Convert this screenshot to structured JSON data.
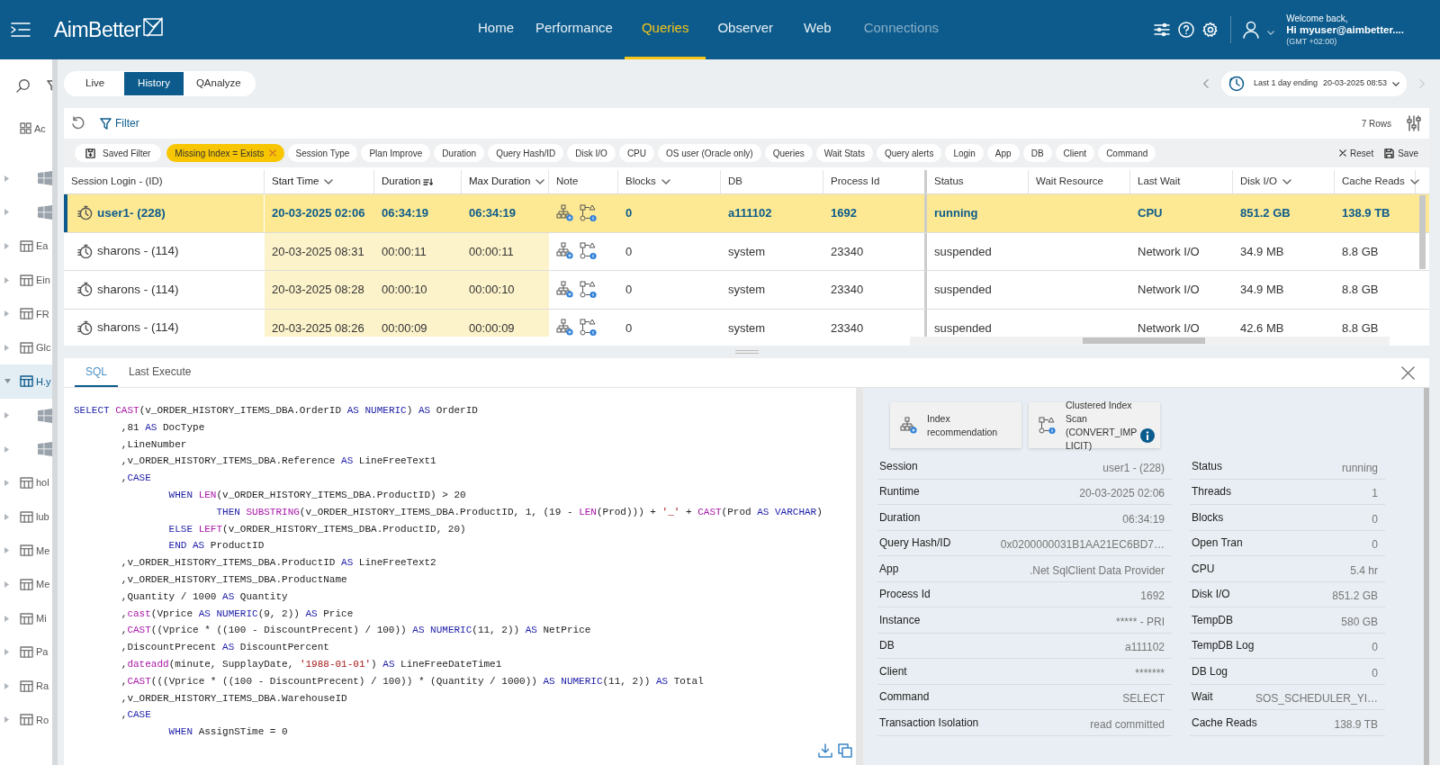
{
  "header": {
    "logo": "AimBetter",
    "nav": [
      {
        "label": "Home",
        "selected": false,
        "disabled": false
      },
      {
        "label": "Performance",
        "selected": false,
        "disabled": false
      },
      {
        "label": "Queries",
        "selected": true,
        "disabled": false
      },
      {
        "label": "Observer",
        "selected": false,
        "disabled": false
      },
      {
        "label": "Web",
        "selected": false,
        "disabled": false
      },
      {
        "label": "Connections",
        "selected": false,
        "disabled": true
      }
    ],
    "user": {
      "greeting": "Welcome back,",
      "name": "Hi myuser@aimbetter....",
      "timezone": "(GMT +02:00)"
    }
  },
  "sidebar": {
    "items": [
      {
        "kind": "grid",
        "label": "Ac",
        "selected": false
      },
      {
        "kind": "windows",
        "selected": false
      },
      {
        "kind": "windows",
        "selected": false
      },
      {
        "kind": "table",
        "label": "Ea",
        "selected": false
      },
      {
        "kind": "table",
        "label": "Ein",
        "selected": false
      },
      {
        "kind": "table",
        "label": "FR",
        "selected": false
      },
      {
        "kind": "table",
        "label": "Glc",
        "selected": false
      },
      {
        "kind": "table",
        "label": "H.y",
        "selected": true
      },
      {
        "kind": "windows",
        "selected": false
      },
      {
        "kind": "windows",
        "selected": false
      },
      {
        "kind": "table",
        "label": "hol",
        "selected": false
      },
      {
        "kind": "table",
        "label": "lub",
        "selected": false
      },
      {
        "kind": "table",
        "label": "Me",
        "selected": false
      },
      {
        "kind": "table",
        "label": "Me",
        "selected": false
      },
      {
        "kind": "table",
        "label": "Mi",
        "selected": false
      },
      {
        "kind": "table",
        "label": "Pa",
        "selected": false
      },
      {
        "kind": "table",
        "label": "Ra",
        "selected": false
      },
      {
        "kind": "table",
        "label": "Ro",
        "selected": false
      }
    ]
  },
  "mode_tabs": [
    {
      "label": "Live",
      "selected": false
    },
    {
      "label": "History",
      "selected": true
    },
    {
      "label": "QAnalyze",
      "selected": false
    }
  ],
  "date_range": {
    "label": "Last 1 day ending",
    "date": "20-03-2025 08:53"
  },
  "toolbar": {
    "filter": "Filter",
    "rows": "7 Rows"
  },
  "chips": [
    {
      "label": "Saved Filter",
      "kind": "saved",
      "active": false
    },
    {
      "label": "Missing Index = Exists",
      "kind": "filter",
      "active": true
    },
    {
      "label": "Session Type",
      "kind": "filter",
      "active": false
    },
    {
      "label": "Plan Improve",
      "kind": "filter",
      "active": false
    },
    {
      "label": "Duration",
      "kind": "filter",
      "active": false
    },
    {
      "label": "Query Hash/ID",
      "kind": "filter",
      "active": false
    },
    {
      "label": "Disk I/O",
      "kind": "filter",
      "active": false
    },
    {
      "label": "CPU",
      "kind": "filter",
      "active": false
    },
    {
      "label": "OS user (Oracle only)",
      "kind": "filter",
      "active": false
    },
    {
      "label": "Queries",
      "kind": "filter",
      "active": false
    },
    {
      "label": "Wait Stats",
      "kind": "filter",
      "active": false
    },
    {
      "label": "Query alerts",
      "kind": "filter",
      "active": false
    },
    {
      "label": "Login",
      "kind": "filter",
      "active": false
    },
    {
      "label": "App",
      "kind": "filter",
      "active": false
    },
    {
      "label": "DB",
      "kind": "filter",
      "active": false
    },
    {
      "label": "Client",
      "kind": "filter",
      "active": false
    },
    {
      "label": "Command",
      "kind": "filter",
      "active": false
    }
  ],
  "chip_actions": {
    "reset": "Reset",
    "save": "Save"
  },
  "table": {
    "columns": [
      {
        "label": "Session Login - (ID)",
        "kind": "session",
        "sortable": false,
        "sorted": false,
        "highlighted": false,
        "frozen_edge": false
      },
      {
        "label": "Start Time",
        "kind": "text",
        "sortable": true,
        "sorted": false,
        "highlighted": true,
        "frozen_edge": false
      },
      {
        "label": "Duration",
        "kind": "text",
        "sortable": false,
        "sorted": true,
        "highlighted": true,
        "frozen_edge": false
      },
      {
        "label": "Max Duration",
        "kind": "text",
        "sortable": true,
        "sorted": false,
        "highlighted": true,
        "frozen_edge": false
      },
      {
        "label": "Note",
        "kind": "icons",
        "sortable": false,
        "sorted": false,
        "highlighted": false,
        "frozen_edge": false
      },
      {
        "label": "Blocks",
        "kind": "text",
        "sortable": true,
        "sorted": false,
        "highlighted": false,
        "frozen_edge": false
      },
      {
        "label": "DB",
        "kind": "text",
        "sortable": false,
        "sorted": false,
        "highlighted": false,
        "frozen_edge": false
      },
      {
        "label": "Process Id",
        "kind": "text",
        "sortable": false,
        "sorted": false,
        "highlighted": false,
        "frozen_edge": true
      },
      {
        "label": "Status",
        "kind": "text",
        "sortable": false,
        "sorted": false,
        "highlighted": false,
        "frozen_edge": false
      },
      {
        "label": "Wait Resource",
        "kind": "text",
        "sortable": false,
        "sorted": false,
        "highlighted": false,
        "frozen_edge": false
      },
      {
        "label": "Last Wait",
        "kind": "text",
        "sortable": false,
        "sorted": false,
        "highlighted": false,
        "frozen_edge": false
      },
      {
        "label": "Disk I/O",
        "kind": "text",
        "sortable": true,
        "sorted": false,
        "highlighted": false,
        "frozen_edge": false
      },
      {
        "label": "Cache Reads",
        "kind": "text",
        "sortable": true,
        "sorted": false,
        "highlighted": false,
        "frozen_edge": false
      }
    ],
    "rows": [
      {
        "selected": true,
        "cells": [
          "user1- (228)",
          "20-03-2025 02:06",
          "06:34:19",
          "06:34:19",
          null,
          "0",
          "a111102",
          "1692",
          "running",
          null,
          "CPU",
          "851.2 GB",
          "138.9 TB"
        ]
      },
      {
        "selected": false,
        "cells": [
          "sharons - (114)",
          "20-03-2025 08:31",
          "00:00:11",
          "00:00:11",
          null,
          "0",
          "system",
          "23340",
          "suspended",
          null,
          "Network I/O",
          "34.9 MB",
          "8.8 GB"
        ]
      },
      {
        "selected": false,
        "cells": [
          "sharons - (114)",
          "20-03-2025 08:28",
          "00:00:10",
          "00:00:10",
          null,
          "0",
          "system",
          "23340",
          "suspended",
          null,
          "Network I/O",
          "34.9 MB",
          "8.8 GB"
        ]
      },
      {
        "selected": false,
        "cells": [
          "sharons - (114)",
          "20-03-2025 08:26",
          "00:00:09",
          "00:00:09",
          null,
          "0",
          "system",
          "23340",
          "suspended",
          null,
          "Network I/O",
          "42.6 MB",
          "8.8 GB"
        ]
      }
    ]
  },
  "detail_tabs": [
    {
      "label": "SQL",
      "selected": true
    },
    {
      "label": "Last Execute",
      "selected": false
    }
  ],
  "sql": [
    [
      {
        "kind": "keyword",
        "text": "SELECT "
      },
      {
        "kind": "function",
        "text": "CAST"
      },
      {
        "kind": "plain",
        "text": "(v_ORDER_HISTORY_ITEMS_DBA.OrderID "
      },
      {
        "kind": "keyword",
        "text": "AS NUMERIC"
      },
      {
        "kind": "plain",
        "text": ") "
      },
      {
        "kind": "keyword",
        "text": "AS"
      },
      {
        "kind": "plain",
        "text": " OrderID"
      }
    ],
    [
      {
        "kind": "plain",
        "text": "        ,81 "
      },
      {
        "kind": "keyword",
        "text": "AS"
      },
      {
        "kind": "plain",
        "text": " DocType"
      }
    ],
    [
      {
        "kind": "plain",
        "text": "        ,LineNumber"
      }
    ],
    [
      {
        "kind": "plain",
        "text": "        ,v_ORDER_HISTORY_ITEMS_DBA.Reference "
      },
      {
        "kind": "keyword",
        "text": "AS"
      },
      {
        "kind": "plain",
        "text": " LineFreeText1"
      }
    ],
    [
      {
        "kind": "plain",
        "text": "        ,"
      },
      {
        "kind": "keyword",
        "text": "CASE"
      }
    ],
    [
      {
        "kind": "keyword",
        "text": "                WHEN "
      },
      {
        "kind": "function",
        "text": "LEN"
      },
      {
        "kind": "plain",
        "text": "(v_ORDER_HISTORY_ITEMS_DBA.ProductID) > 20"
      }
    ],
    [
      {
        "kind": "keyword",
        "text": "                        THEN "
      },
      {
        "kind": "function",
        "text": "SUBSTRING"
      },
      {
        "kind": "plain",
        "text": "(v_ORDER_HISTORY_ITEMS_DBA.ProductID, 1, (19 - "
      },
      {
        "kind": "function",
        "text": "LEN"
      },
      {
        "kind": "plain",
        "text": "(Prod))) + "
      },
      {
        "kind": "string",
        "text": "'_'"
      },
      {
        "kind": "plain",
        "text": " + "
      },
      {
        "kind": "function",
        "text": "CAST"
      },
      {
        "kind": "plain",
        "text": "(Prod "
      },
      {
        "kind": "keyword",
        "text": "AS VARCHAR"
      },
      {
        "kind": "plain",
        "text": ")"
      }
    ],
    [
      {
        "kind": "keyword",
        "text": "                ELSE "
      },
      {
        "kind": "function",
        "text": "LEFT"
      },
      {
        "kind": "plain",
        "text": "(v_ORDER_HISTORY_ITEMS_DBA.ProductID, 20)"
      }
    ],
    [
      {
        "kind": "keyword",
        "text": "                END AS"
      },
      {
        "kind": "plain",
        "text": " ProductID"
      }
    ],
    [
      {
        "kind": "plain",
        "text": "        ,v_ORDER_HISTORY_ITEMS_DBA.ProductID "
      },
      {
        "kind": "keyword",
        "text": "AS"
      },
      {
        "kind": "plain",
        "text": " LineFreeText2"
      }
    ],
    [
      {
        "kind": "plain",
        "text": "        ,v_ORDER_HISTORY_ITEMS_DBA.ProductName"
      }
    ],
    [
      {
        "kind": "plain",
        "text": "        ,Quantity / 1000 "
      },
      {
        "kind": "keyword",
        "text": "AS"
      },
      {
        "kind": "plain",
        "text": " Quantity"
      }
    ],
    [
      {
        "kind": "plain",
        "text": "        ,"
      },
      {
        "kind": "function",
        "text": "cast"
      },
      {
        "kind": "plain",
        "text": "(Vprice "
      },
      {
        "kind": "keyword",
        "text": "AS NUMERIC"
      },
      {
        "kind": "plain",
        "text": "(9, 2)) "
      },
      {
        "kind": "keyword",
        "text": "AS"
      },
      {
        "kind": "plain",
        "text": " Price"
      }
    ],
    [
      {
        "kind": "plain",
        "text": "        ,"
      },
      {
        "kind": "function",
        "text": "CAST"
      },
      {
        "kind": "plain",
        "text": "((Vprice * ((100 - DiscountPrecent) / 100)) "
      },
      {
        "kind": "keyword",
        "text": "AS NUMERIC"
      },
      {
        "kind": "plain",
        "text": "(11, 2)) "
      },
      {
        "kind": "keyword",
        "text": "AS"
      },
      {
        "kind": "plain",
        "text": " NetPrice"
      }
    ],
    [
      {
        "kind": "plain",
        "text": "        ,DiscountPrecent "
      },
      {
        "kind": "keyword",
        "text": "AS"
      },
      {
        "kind": "plain",
        "text": " DiscountPercent"
      }
    ],
    [
      {
        "kind": "plain",
        "text": "        ,"
      },
      {
        "kind": "function",
        "text": "dateadd"
      },
      {
        "kind": "plain",
        "text": "(minute, SupplayDate, "
      },
      {
        "kind": "string",
        "text": "'1988-01-01'"
      },
      {
        "kind": "plain",
        "text": ") "
      },
      {
        "kind": "keyword",
        "text": "AS"
      },
      {
        "kind": "plain",
        "text": " LineFreeDateTime1"
      }
    ],
    [
      {
        "kind": "plain",
        "text": "        ,"
      },
      {
        "kind": "function",
        "text": "CAST"
      },
      {
        "kind": "plain",
        "text": "(((Vprice * ((100 - DiscountPrecent) / 100)) * (Quantity / 1000)) "
      },
      {
        "kind": "keyword",
        "text": "AS NUMERIC"
      },
      {
        "kind": "plain",
        "text": "(11, 2)) "
      },
      {
        "kind": "keyword",
        "text": "AS"
      },
      {
        "kind": "plain",
        "text": " Total"
      }
    ],
    [
      {
        "kind": "plain",
        "text": "        ,v_ORDER_HISTORY_ITEMS_DBA.WarehouseID"
      }
    ],
    [
      {
        "kind": "plain",
        "text": "        ,"
      },
      {
        "kind": "keyword",
        "text": "CASE"
      }
    ],
    [
      {
        "kind": "keyword",
        "text": "                WHEN"
      },
      {
        "kind": "plain",
        "text": " AssignSTime = 0"
      }
    ]
  ],
  "cards": [
    {
      "label": "Index recommendation",
      "kind": "index",
      "info": false
    },
    {
      "label": "Clustered Index Scan (CONVERT_IMPLICIT)",
      "kind": "plan",
      "info": true
    }
  ],
  "details_left": [
    {
      "label": "Session",
      "value": "user1 - (228)"
    },
    {
      "label": "Runtime",
      "value": "20-03-2025 02:06"
    },
    {
      "label": "Duration",
      "value": "06:34:19"
    },
    {
      "label": "Query Hash/ID",
      "value": "0x0200000031B1AA21EC6BD7…"
    },
    {
      "label": "App",
      "value": ".Net SqlClient Data Provider"
    },
    {
      "label": "Process Id",
      "value": "1692"
    },
    {
      "label": "Instance",
      "value": "***** - PRI"
    },
    {
      "label": "DB",
      "value": "a111102"
    },
    {
      "label": "Client",
      "value": "*******"
    },
    {
      "label": "Command",
      "value": "SELECT"
    },
    {
      "label": "Transaction Isolation",
      "value": "read committed"
    }
  ],
  "details_right": [
    {
      "label": "Status",
      "value": "running"
    },
    {
      "label": "Threads",
      "value": "1"
    },
    {
      "label": "Blocks",
      "value": "0"
    },
    {
      "label": "Open Tran",
      "value": "0"
    },
    {
      "label": "CPU",
      "value": "5.4 hr"
    },
    {
      "label": "Disk I/O",
      "value": "851.2 GB"
    },
    {
      "label": "TempDB",
      "value": "580 GB"
    },
    {
      "label": "TempDB Log",
      "value": "0"
    },
    {
      "label": "DB Log",
      "value": "0"
    },
    {
      "label": "Wait",
      "value": "SOS_SCHEDULER_YI…"
    },
    {
      "label": "Cache Reads",
      "value": "138.9 TB"
    }
  ]
}
